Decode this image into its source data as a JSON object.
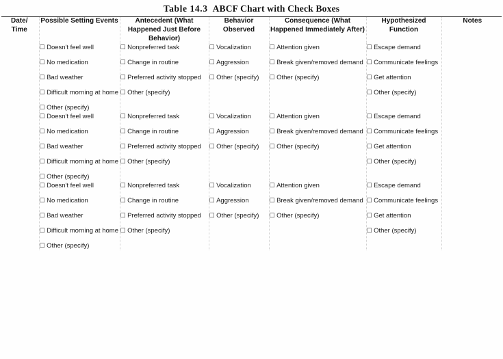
{
  "title": {
    "number": "Table 14.3",
    "name": "ABCF Chart with Check Boxes"
  },
  "columns": {
    "date_time": "Date/\nTime",
    "date_time_line1": "Date/",
    "date_time_line2": "Time",
    "setting_events": "Possible Setting Events",
    "antecedent": "Antecedent (What Happened Just Before Behavior)",
    "behavior": "Behavior Observed",
    "consequence": "Consequence (What Happened Immediately After)",
    "hypothesized_function": "Hypothesized Function",
    "notes": "Notes"
  },
  "options": {
    "setting_events": [
      "Doesn't feel well",
      "No medication",
      "Bad weather",
      "Difficult morning at home",
      "Other (specify)"
    ],
    "antecedent": [
      "Nonpreferred task",
      "Change in routine",
      "Preferred activity stopped",
      "Other (specify)"
    ],
    "behavior": [
      "Vocalization",
      "Aggression",
      "Other (specify)"
    ],
    "consequence": [
      "Attention given",
      "Break given/removed demand",
      "Other (specify)"
    ],
    "hypothesized_function": [
      "Escape demand",
      "Communicate feelings",
      "Get attention",
      "Other (specify)"
    ],
    "notes": []
  },
  "checkbox_glyph": "☐",
  "row_count": 3,
  "rows": [
    {
      "date_time": "",
      "notes": ""
    },
    {
      "date_time": "",
      "notes": ""
    },
    {
      "date_time": "",
      "notes": ""
    }
  ],
  "colors": {
    "text": "#1a1a1a",
    "rule": "#2a2a2a",
    "separator": "#cfcfcf",
    "background": "#fefefe"
  }
}
